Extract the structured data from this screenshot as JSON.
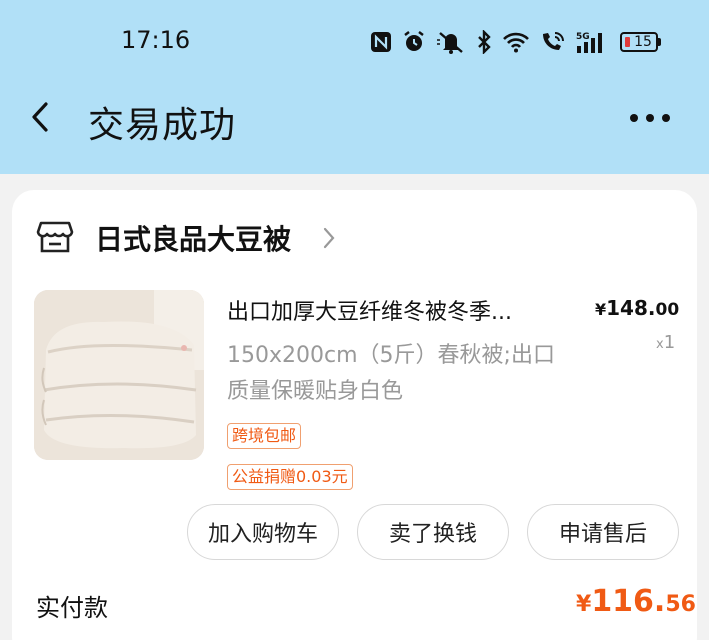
{
  "status_bar": {
    "time": "17:16",
    "battery_level": "15",
    "icons": [
      "nfc-icon",
      "alarm-icon",
      "mute-icon",
      "bluetooth-icon",
      "wifi-icon",
      "call-wifi-icon",
      "5g-signal-icon",
      "battery-icon"
    ]
  },
  "header": {
    "title": "交易成功"
  },
  "store": {
    "name": "日式良品大豆被"
  },
  "product": {
    "title": "出口加厚大豆纤维冬被冬季...",
    "sku": "150x200cm（5斤）春秋被;出口质量保暖贴身白色",
    "price_symbol": "¥",
    "price_int": "148.",
    "price_cents": "00",
    "qty_prefix": "x",
    "qty": "1",
    "tags": [
      "跨境包邮",
      "公益捐赠0.03元"
    ]
  },
  "actions": {
    "add_cart": "加入购物车",
    "sell": "卖了换钱",
    "after_sale": "申请售后"
  },
  "payment": {
    "label": "实付款",
    "symbol": "¥",
    "amount_int": "116.",
    "amount_cents": "56"
  },
  "colors": {
    "header_bg": "#b1e0f7",
    "accent": "#f05a14",
    "battery_low": "#e03a3a"
  }
}
